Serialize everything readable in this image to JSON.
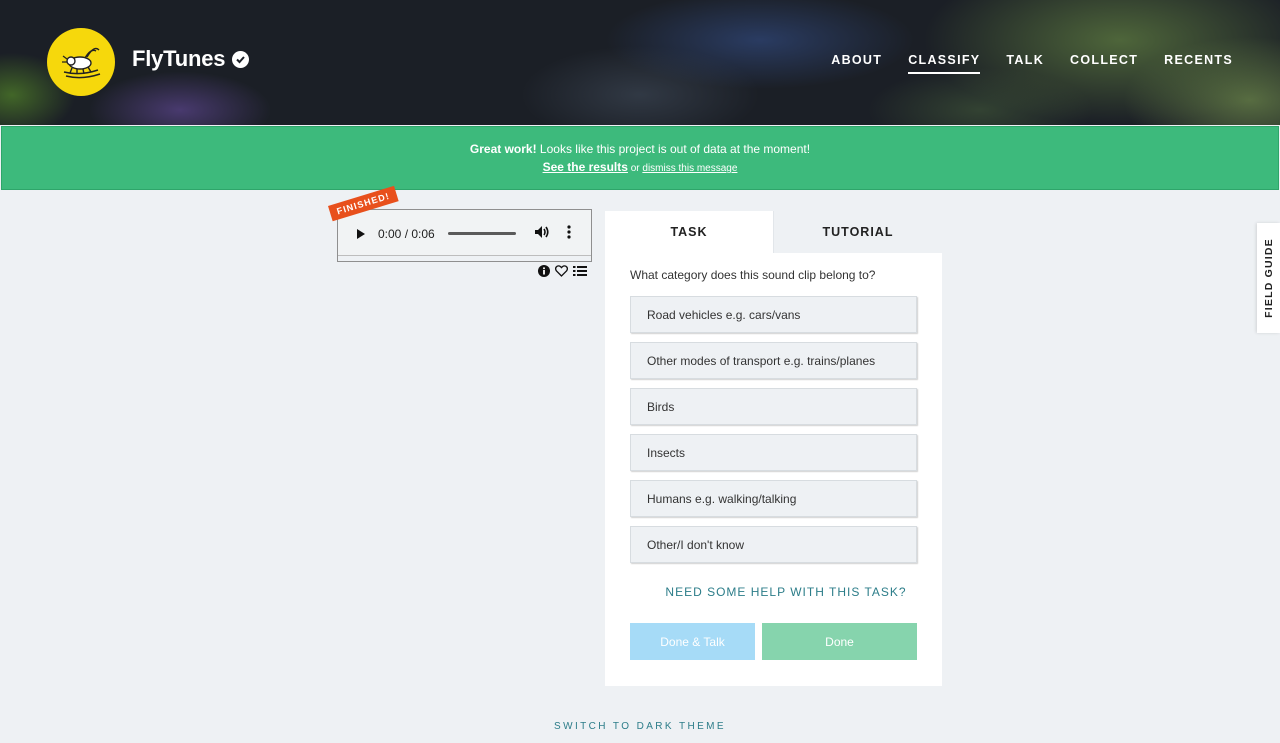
{
  "header": {
    "project_name": "FlyTunes",
    "nav": [
      {
        "label": "ABOUT",
        "active": false
      },
      {
        "label": "CLASSIFY",
        "active": true
      },
      {
        "label": "TALK",
        "active": false
      },
      {
        "label": "COLLECT",
        "active": false
      },
      {
        "label": "RECENTS",
        "active": false
      }
    ]
  },
  "banner": {
    "strong": "Great work!",
    "message": " Looks like this project is out of data at the moment!",
    "results_link": "See the results",
    "or_text": " or ",
    "dismiss_link": "dismiss this message",
    "color": "#3dba7c"
  },
  "subject": {
    "badge": "FINISHED!",
    "time": "0:00 / 0:06",
    "tools": [
      "info-icon",
      "heart-icon",
      "list-icon"
    ]
  },
  "task_panel": {
    "tabs": [
      {
        "label": "TASK",
        "active": true
      },
      {
        "label": "TUTORIAL",
        "active": false
      }
    ],
    "question": "What category does this sound clip belong to?",
    "answers": [
      "Road vehicles e.g. cars/vans",
      "Other modes of transport e.g. trains/planes",
      "Birds",
      "Insects",
      "Humans e.g. walking/talking",
      "Other/I don't know"
    ],
    "help": "NEED SOME HELP WITH THIS TASK?",
    "done_talk_label": "Done & Talk",
    "done_label": "Done"
  },
  "field_guide": "FIELD GUIDE",
  "theme_switch": "SWITCH TO DARK THEME",
  "colors": {
    "accent_teal": "#2c7d89",
    "done_green": "#86d4ad",
    "done_talk_blue": "#a6dbf7",
    "finished_orange": "#e8501c",
    "logo_yellow": "#f6d80c"
  }
}
